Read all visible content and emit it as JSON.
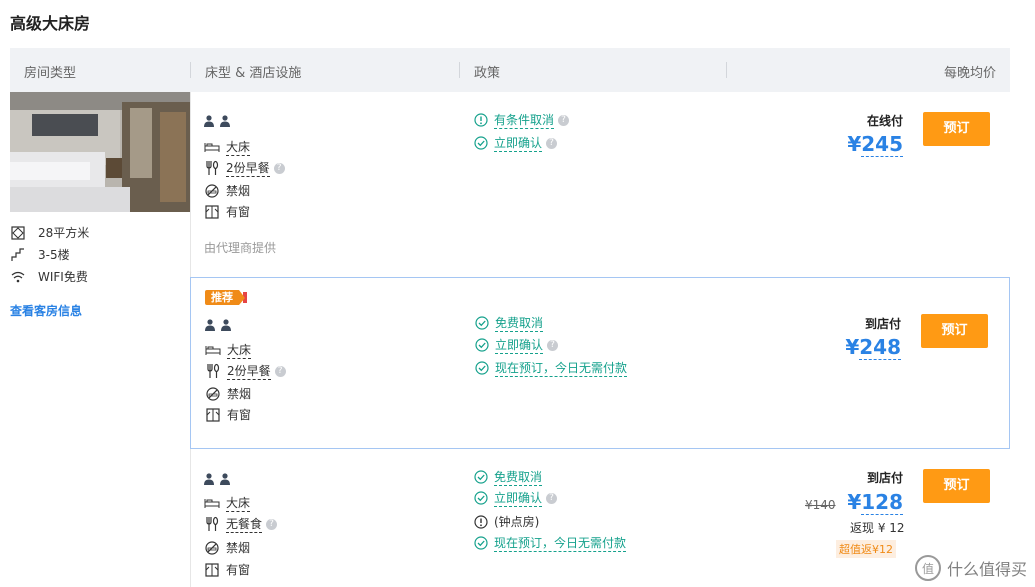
{
  "section_title": "高级大床房",
  "header": {
    "room_type": "房间类型",
    "bed_facilities": "床型 & 酒店设施",
    "policy": "政策",
    "avg_price": "每晚均价"
  },
  "room": {
    "features": [
      {
        "icon": "area-icon",
        "label": "28平方米"
      },
      {
        "icon": "floor-icon",
        "label": "3-5楼"
      },
      {
        "icon": "wifi-icon",
        "label": "WIFI免费"
      }
    ],
    "details_link": "查看客房信息"
  },
  "rows": [
    {
      "bed": "大床",
      "breakfast": "2份早餐",
      "smoking": "禁烟",
      "window": "有窗",
      "agent_note": "由代理商提供",
      "policies": [
        "有条件取消",
        "立即确认"
      ],
      "pay_label": "在线付",
      "currency": "¥",
      "price": "245",
      "book_label": "预订"
    },
    {
      "tag": "推荐",
      "bed": "大床",
      "breakfast": "2份早餐",
      "smoking": "禁烟",
      "window": "有窗",
      "policies": [
        "免费取消",
        "立即确认",
        "现在预订，今日无需付款"
      ],
      "pay_label": "到店付",
      "currency": "¥",
      "price": "248",
      "book_label": "预订"
    },
    {
      "bed": "大床",
      "breakfast": "无餐食",
      "smoking": "禁烟",
      "window": "有窗",
      "policies": [
        "免费取消",
        "立即确认",
        "(钟点房)",
        "现在预订，今日无需付款"
      ],
      "pay_label": "到店付",
      "old_price": "¥140",
      "currency": "¥",
      "price": "128",
      "cashback": "返现 ¥ 12",
      "deal": "超值返¥12",
      "book_label": "预订"
    }
  ],
  "watermark": "什么值得买",
  "colors": {
    "accent": "#2a82e4",
    "button": "#ff9a14",
    "policy": "#15a18c",
    "tag": "#f08b17"
  }
}
